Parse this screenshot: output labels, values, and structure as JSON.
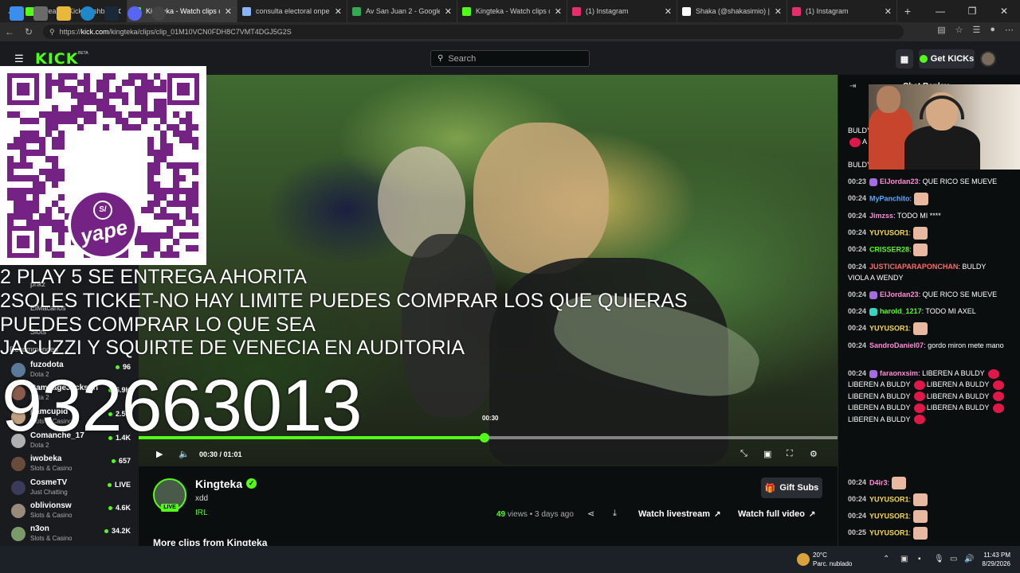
{
  "browser": {
    "tabs": [
      {
        "title": "Stream - Kick Dashboard",
        "favicon_color": "#53fc18",
        "active": false,
        "width": 134
      },
      {
        "title": "Kingteka - Watch clips on Kick",
        "favicon_color": "#53fc18",
        "active": true,
        "width": 138
      },
      {
        "title": "consulta electoral onpe - Se",
        "favicon_color": "#8ab4f8",
        "active": false,
        "width": 138
      },
      {
        "title": "Av San Juan 2 - Google Maps",
        "favicon_color": "#34a853",
        "active": false,
        "width": 138
      },
      {
        "title": "Kingteka - Watch clips on Kick",
        "favicon_color": "#53fc18",
        "active": false,
        "width": 138
      },
      {
        "title": "(1) Instagram",
        "favicon_color": "#e1306c",
        "active": false,
        "width": 138
      },
      {
        "title": "Shaka (@shakasimio) | TikTok",
        "favicon_color": "#ffffff",
        "active": false,
        "width": 138
      },
      {
        "title": "(1) Instagram",
        "favicon_color": "#e1306c",
        "active": false,
        "width": 138
      }
    ],
    "url_prefix": "https://",
    "url_domain": "kick.com",
    "url_path": "/kingteka/clips/clip_01M10VCN0FDH8C7VMT4DGJ5G2S"
  },
  "header": {
    "logo": "KICK",
    "beta": "BETA",
    "search_placeholder": "Search",
    "get_kicks": "Get KICKs"
  },
  "sidebar": {
    "faint_items": [
      "pnkz",
      "ElMacarios",
      "Slots"
    ],
    "recommended": "Recommended",
    "channels": [
      {
        "name": "fuzodota",
        "category": "Dota 2",
        "viewers": "96",
        "color": "#5a7a9a"
      },
      {
        "name": "RampageJackson",
        "category": "Dota 2",
        "viewers": "6.9K",
        "color": "#8a5a4a"
      },
      {
        "name": "pamcupid",
        "category": "Slots & Casino",
        "viewers": "2.5K",
        "color": "#c0a080"
      },
      {
        "name": "Comanche_17",
        "category": "Dota 2",
        "viewers": "1.4K",
        "color": "#b0b0b0"
      },
      {
        "name": "iwobeka",
        "category": "Slots & Casino",
        "viewers": "657",
        "color": "#6a4a3a"
      },
      {
        "name": "CosmeTV",
        "category": "Just Chatting",
        "viewers": "LIVE",
        "color": "#3a3a5a"
      },
      {
        "name": "oblivionsw",
        "category": "Slots & Casino",
        "viewers": "4.6K",
        "color": "#9a8a7a"
      },
      {
        "name": "n3on",
        "category": "Slots & Casino",
        "viewers": "34.2K",
        "color": "#7a9a6a"
      }
    ]
  },
  "overlay": {
    "lines": [
      "2 PLAY 5 SE ENTREGA AHORITA",
      "2SOLES TICKET-NO HAY LIMITE PUEDES COMPRAR LOS QUE QUIERAS",
      "PUEDES COMPRAR LO QUE SEA",
      "JACUZZI Y SQUIRTE DE VENECIA EN AUDITORIA"
    ],
    "phone": "932663013",
    "qr_brand": "yape",
    "qr_symbol": "S/"
  },
  "player": {
    "hover_time": "00:30",
    "time": "00:30 / 01:01",
    "progress_fraction": 0.495
  },
  "clip": {
    "channel": "Kingteka",
    "live_badge": "LIVE",
    "title": "xdd",
    "category": "IRL",
    "gift_subs": "Gift Subs",
    "views_count": "49",
    "views_word": "views",
    "age": "3 days ago",
    "watch_livestream": "Watch livestream",
    "watch_full_video": "Watch full video",
    "more_clips": "More clips from Kingteka"
  },
  "chat": {
    "title": "Chat Replay",
    "top_fragments": [
      "BULDY",
      "A",
      "BULDY"
    ],
    "messages": [
      {
        "time": "00:23",
        "user": "ElJordan23",
        "color": "#ff8ad6",
        "badge": "#a56be0",
        "text": "QUE RICO SE MUEVE"
      },
      {
        "time": "00:24",
        "user": "MyPanchito",
        "color": "#5aa7ff",
        "badge": "",
        "text": "",
        "emote": true
      },
      {
        "time": "00:24",
        "user": "Jimzss",
        "color": "#ff8ad6",
        "badge": "",
        "text": "TODO MI ****"
      },
      {
        "time": "00:24",
        "user": "YUYUSOR1",
        "color": "#f5d94a",
        "badge": "",
        "text": "",
        "emote": true
      },
      {
        "time": "00:24",
        "user": "CRISSER28",
        "color": "#53fc18",
        "badge": "",
        "text": "",
        "emote": true
      },
      {
        "time": "00:24",
        "user": "JUSTICIAPARAPONCHAN",
        "color": "#ff6b6b",
        "badge": "",
        "text": "BULDY VIOLA A WENDY"
      },
      {
        "time": "00:24",
        "user": "ElJordan23",
        "color": "#ff8ad6",
        "badge": "#a56be0",
        "text": "QUE RICO SE MUEVE"
      },
      {
        "time": "00:24",
        "user": "harold_1217",
        "color": "#53fc18",
        "badge": "#3ad4c7",
        "text": "TODO MI AXEL"
      },
      {
        "time": "00:24",
        "user": "YUYUSOR1",
        "color": "#f5d94a",
        "badge": "",
        "text": "",
        "emote": true
      },
      {
        "time": "00:24",
        "user": "SandroDaniel07",
        "color": "#ff8ad6",
        "badge": "",
        "text": "gordo miron mete mano"
      },
      {
        "time": "00:24",
        "user": "faraonxsim",
        "color": "#ff8ad6",
        "badge": "#a56be0",
        "text": "LIBEREN A BULDY",
        "spam": "LIBEREN A BULDY"
      },
      {
        "time": "00:24",
        "user": "D4ir3",
        "color": "#ff8ad6",
        "badge": "",
        "text": "",
        "emote": true
      },
      {
        "time": "00:24",
        "user": "YUYUSOR1",
        "color": "#f5d94a",
        "badge": "",
        "text": "",
        "emote": true
      },
      {
        "time": "00:24",
        "user": "YUYUSOR1",
        "color": "#f5d94a",
        "badge": "",
        "text": "",
        "emote": true
      },
      {
        "time": "00:25",
        "user": "YUYUSOR1",
        "color": "#f5d94a",
        "badge": "",
        "text": "",
        "emote": true
      }
    ]
  },
  "taskbar": {
    "weather_temp": "20°C",
    "weather_desc": "Parc. nublado",
    "time": "11:43 PM",
    "date": "8/29/2026"
  }
}
